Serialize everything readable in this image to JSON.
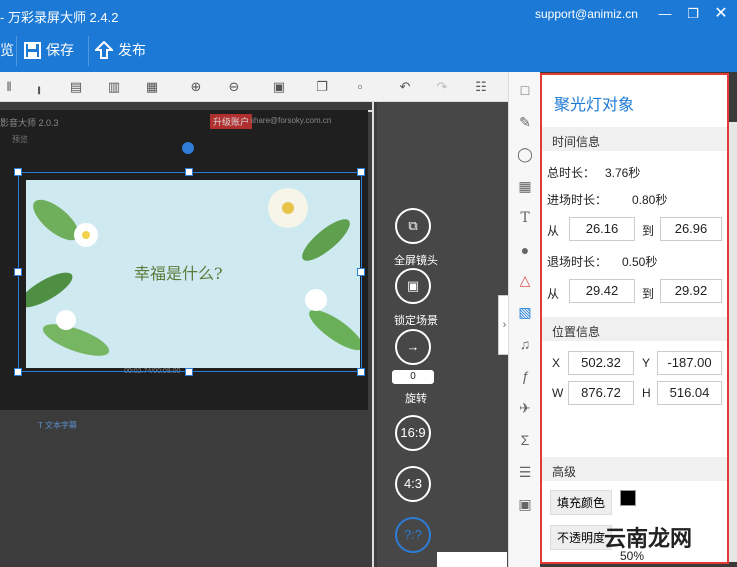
{
  "titlebar": {
    "title": "- 万彩录屏大师 2.4.2",
    "email": "support@animiz.cn"
  },
  "menubar": {
    "item0": "览",
    "save": "保存",
    "publish": "发布"
  },
  "canvas": {
    "inner_title": "影音大师 2.0.3",
    "inner_badge": "升级账户",
    "inner_email": "share@forsoky.com.cn",
    "inner_bar_left": "预览",
    "inner_time": "00:02.74/00:08.00",
    "inner_caption": "幸福是什么?",
    "inner_subtitle": "T 文本字幕"
  },
  "controls": {
    "fullscreen": "全屏镜头",
    "lock": "锁定场景",
    "rotate_value": "0",
    "rotate": "旋转",
    "ratio1": "16:9",
    "ratio2": "4:3",
    "ratio3": "?:?",
    "zoom": "50%"
  },
  "panel": {
    "title": "聚光灯对象",
    "time_section": "时间信息",
    "total_label": "总时长：",
    "total_value": "3.76秒",
    "enter_label": "进场时长：",
    "enter_value": "0.80秒",
    "from1_label": "从",
    "from1_value": "26.16",
    "to1_label": "到",
    "to1_value": "26.96",
    "exit_label": "退场时长：",
    "exit_value": "0.50秒",
    "from2_label": "从",
    "from2_value": "29.42",
    "to2_label": "到",
    "to2_value": "29.92",
    "pos_section": "位置信息",
    "x_label": "X",
    "x_value": "502.32",
    "y_label": "Y",
    "y_value": "-187.00",
    "w_label": "W",
    "w_value": "876.72",
    "h_label": "H",
    "h_value": "516.04",
    "adv_section": "高级",
    "fill_button": "填充颜色",
    "opacity_button": "不透明度",
    "watermark": "云南龙网"
  }
}
